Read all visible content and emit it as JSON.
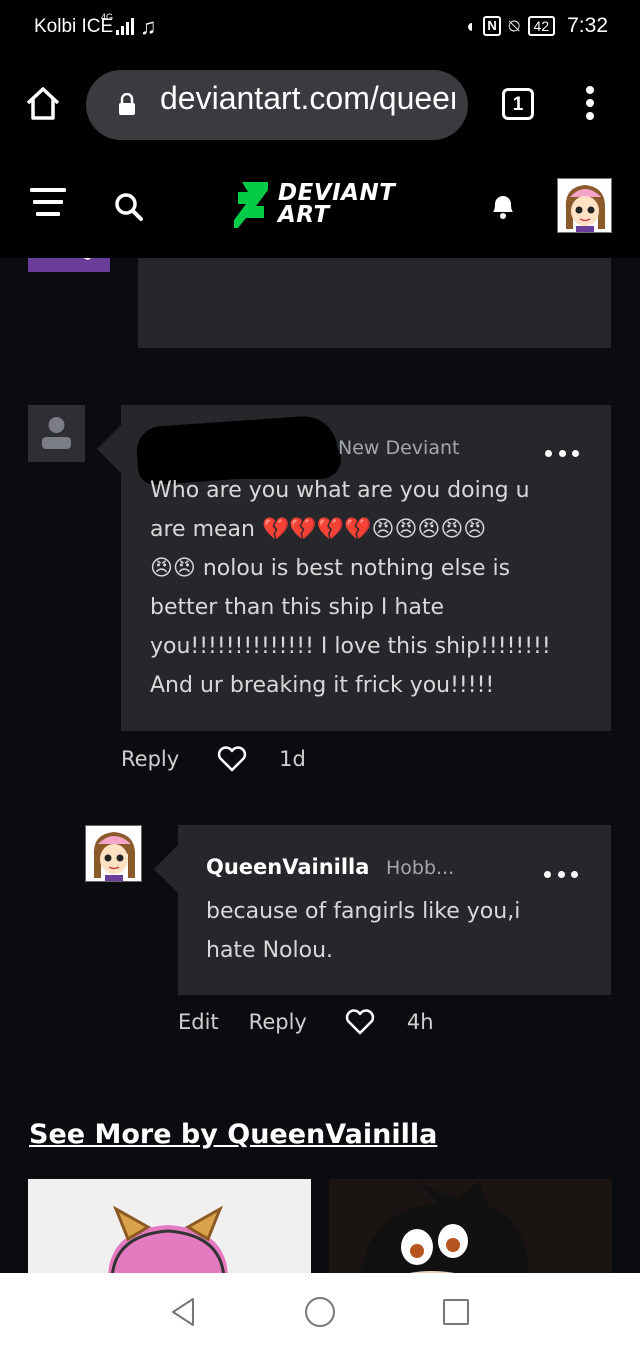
{
  "status_bar": {
    "carrier": "Kolbi ICE",
    "network": "4G",
    "battery": "42",
    "time": "7:32"
  },
  "browser": {
    "url": "deviantart.com/queen",
    "tab_count": "1"
  },
  "header": {
    "logo_line1": "DEVIANT",
    "logo_line2": "ART"
  },
  "comments": [
    {
      "role": "New Deviant",
      "text": "Who are you  what are you doing u\nare mean 💔💔💔💔😠😠😠😠😠\n😠😠 nolou is best nothing else is\nbetter than this ship I hate\nyou!!!!!!!!!!!!!! I love this ship!!!!!!!!\nAnd ur breaking it frick you!!!!!",
      "reply_label": "Reply",
      "time": "1d"
    },
    {
      "username": "QueenVainilla",
      "role": "Hobb...",
      "text": "because of fangirls like you,i\nhate Nolou.",
      "edit_label": "Edit",
      "reply_label": "Reply",
      "time": "4h"
    }
  ],
  "see_more": "See More by QueenVainilla",
  "colors": {
    "background": "#0b0c0f",
    "bubble": "#25272b",
    "brand_green": "#05cc47"
  }
}
